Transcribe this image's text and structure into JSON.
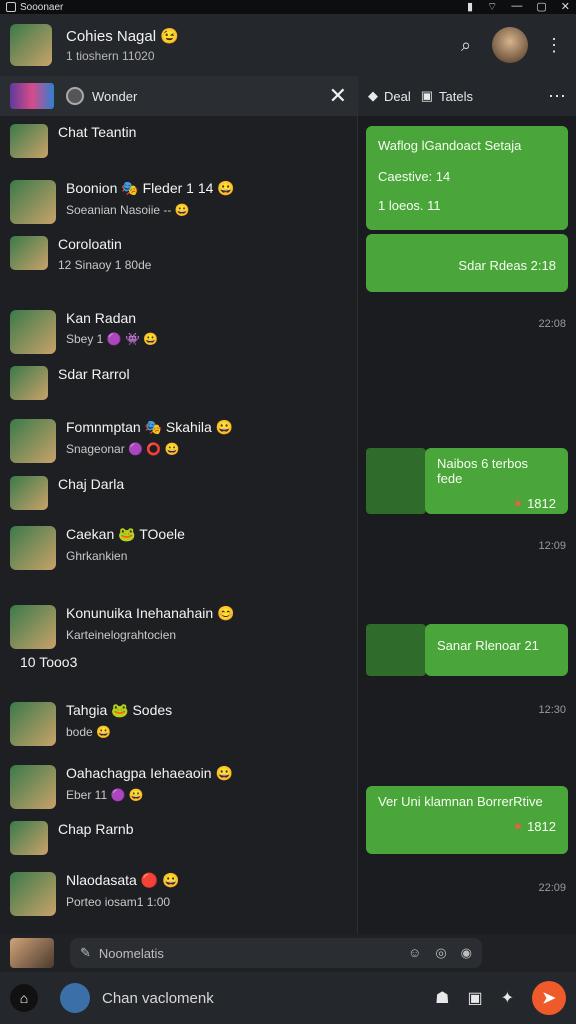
{
  "system_bar": {
    "app_name": "Sooonaer"
  },
  "header": {
    "title": "Cohies Nagal 😉",
    "subtitle": "1 tioshern 11020"
  },
  "search_panel": {
    "label": "Wonder"
  },
  "chats": [
    {
      "name": "Chat Teantin",
      "sub": ""
    },
    {
      "name": "Boonion 🎭 Fleder 1 14 😀",
      "sub": "Soeanian Nasoiie -- 😀"
    },
    {
      "name": "Coroloatin",
      "sub": "12 Sinaoy 1 80de"
    },
    {
      "name": "Kan Radan",
      "sub": "Sbey 1 🟣 👾 😀"
    },
    {
      "name": "Sdar Rarrol",
      "sub": ""
    },
    {
      "name": "Fomnmptan 🎭 Skahila 😀",
      "sub": "Snageonar 🟣 ⭕ 😀"
    },
    {
      "name": "Chaj Darla",
      "sub": ""
    },
    {
      "name": "Caekan 🐸 TOoele",
      "sub": "Ghrkankien"
    },
    {
      "name": "Konunuika Inehanahain 😊",
      "sub": "Karteinelograhtocien"
    },
    {
      "name": "10 Tooo3",
      "sub": ""
    },
    {
      "name": "Tahgia 🐸 Sodes",
      "sub": "bode 😀"
    },
    {
      "name": "Oahachagpa Iehaeaoin 😀",
      "sub": "Eber 11 🟣 😀"
    },
    {
      "name": "Chap Rarnb",
      "sub": ""
    },
    {
      "name": "Nlaodasata 🔴 😀",
      "sub": "Porteo iosam1 1:00"
    }
  ],
  "right_panel": {
    "tab1": "Deal",
    "tab2": "Tatels",
    "bubbles": [
      "Waflog lGandoact Setaja",
      "Caestive: 14",
      "1 loeos. 11",
      "Sdar Rdeas 2:18",
      "Naibos 6 terbos fede",
      "Sanar Rlenoar 21",
      "Ver Uni klamnan BorrerRtive"
    ],
    "badges": [
      "1812",
      "1812"
    ],
    "timestamps": [
      "22:08",
      "12:09",
      "12:30",
      "22:09"
    ]
  },
  "composer": {
    "placeholder": "Noomelatis"
  },
  "bottom": {
    "label": "Chan vaclomenk"
  }
}
